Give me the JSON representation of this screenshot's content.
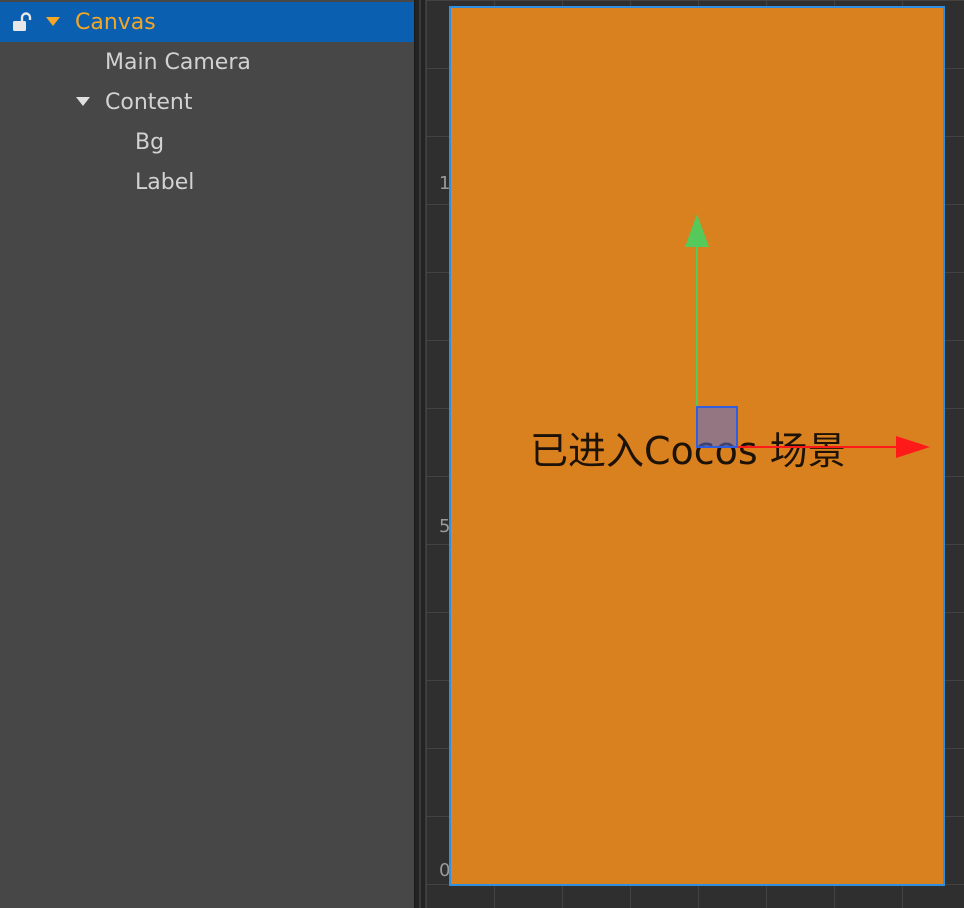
{
  "hierarchy": {
    "items": [
      {
        "label": "Canvas",
        "selected": true,
        "expanded": true,
        "locked": false
      },
      {
        "label": "Main Camera"
      },
      {
        "label": "Content",
        "expanded": true
      },
      {
        "label": "Bg"
      },
      {
        "label": "Label"
      }
    ]
  },
  "scene": {
    "ruler_labels": [
      "1",
      "5",
      "0"
    ],
    "label_text": "已进入Cocos 场景",
    "canvas_color": "#d9801f",
    "canvas_border_color": "#2f8fe0"
  },
  "colors": {
    "selection_bg": "#0a5fb0",
    "selection_text": "#f5a623",
    "gizmo_y": "#55c95a",
    "gizmo_x": "#ff1a1a"
  },
  "icons": {
    "lock": "unlocked-padlock-icon",
    "caret": "caret-down-icon"
  }
}
